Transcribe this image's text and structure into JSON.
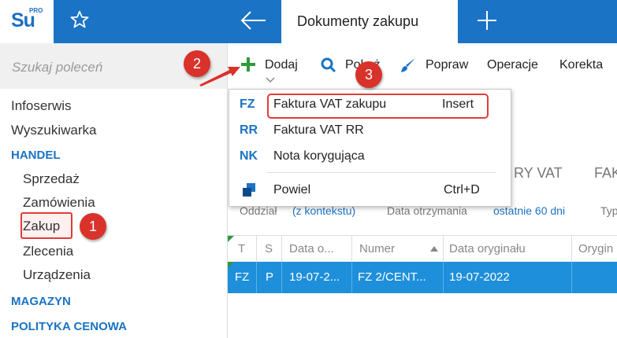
{
  "app": {
    "logo_text": "Su",
    "logo_sup": "PRO"
  },
  "header": {
    "active_tab": "Dokumenty zakupu"
  },
  "sidebar": {
    "search_placeholder": "Szukaj poleceń",
    "items": [
      {
        "label": "Infoserwis",
        "type": "item"
      },
      {
        "label": "Wyszukiwarka",
        "type": "item"
      },
      {
        "label": "HANDEL",
        "type": "header"
      },
      {
        "label": "Sprzedaż",
        "type": "sub"
      },
      {
        "label": "Zamówienia",
        "type": "sub"
      },
      {
        "label": "Zakup",
        "type": "sub"
      },
      {
        "label": "Zlecenia",
        "type": "sub"
      },
      {
        "label": "Urządzenia",
        "type": "sub"
      },
      {
        "label": "MAGAZYN",
        "type": "header"
      },
      {
        "label": "POLITYKA CENOWA",
        "type": "header"
      }
    ]
  },
  "toolbar": {
    "add_label": "Dodaj",
    "show_label": "Pokaż",
    "edit_label": "Popraw",
    "operations_label": "Operacje",
    "correction_label": "Korekta"
  },
  "dropdown": {
    "items": [
      {
        "code": "FZ",
        "label": "Faktura VAT zakupu",
        "shortcut": "Insert"
      },
      {
        "code": "RR",
        "label": "Faktura VAT RR",
        "shortcut": ""
      },
      {
        "code": "NK",
        "label": "Nota korygująca",
        "shortcut": ""
      },
      {
        "code": "",
        "label": "Powiel",
        "shortcut": "Ctrl+D"
      }
    ]
  },
  "subtabs": [
    "RY VAT",
    "FAK"
  ],
  "filters": {
    "branch_label": "Oddział",
    "branch_value": "(z kontekstu)",
    "date_label": "Data otrzymania",
    "date_value": "ostatnie 60 dni",
    "type_label": "Typ"
  },
  "table": {
    "headers": [
      "T",
      "S",
      "Data o...",
      "Numer",
      "Data oryginału",
      "Orygin"
    ],
    "rows": [
      {
        "t": "FZ",
        "s": "P",
        "date": "19-07-2...",
        "number": "FZ 2/CENT...",
        "orig_date": "19-07-2022",
        "orig": ""
      }
    ]
  },
  "annotations": {
    "step1": "1",
    "step2": "2",
    "step3": "3"
  },
  "colors": {
    "accent": "#1a73c4",
    "highlight": "#e23b3b",
    "selected_row": "#1e8fdb",
    "add_icon": "#2e9b3a"
  }
}
